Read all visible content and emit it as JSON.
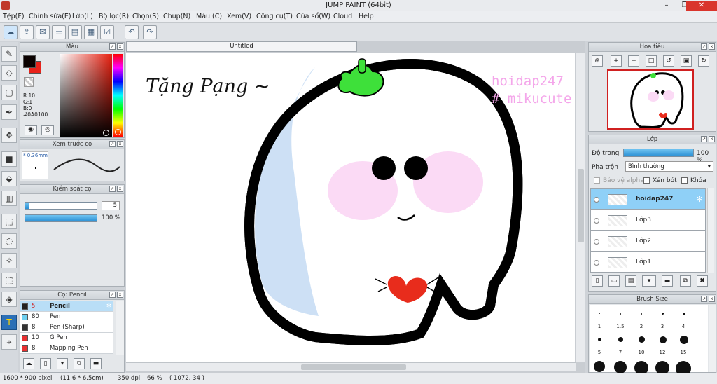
{
  "window": {
    "title": "JUMP PAINT (64bit)",
    "minimize": "–",
    "maximize": "❐",
    "close": "✕"
  },
  "menu": [
    "Tệp(F)",
    "Chỉnh sửa(E)",
    "Lớp(L)",
    "Bộ lọc(R)",
    "Chọn(S)",
    "Chụp(N)",
    "Màu (C)",
    "Xem(V)",
    "Công cụ(T)",
    "Cửa sổ(W)",
    "Cloud",
    "Help"
  ],
  "toolbar": {
    "undo": "↶",
    "redo": "↷"
  },
  "color_panel": {
    "title": "Màu",
    "r": "R:10",
    "g": "G:1",
    "b": "B:0",
    "hex": "#0A0100",
    "main_color": "#0a0100",
    "sub_color": "#e8221a"
  },
  "brush_preview": {
    "title": "Xem trước cọ",
    "size": "0.36mm"
  },
  "brush_control": {
    "title": "Kiểm soát cọ",
    "size_value": "5",
    "opacity_label": "100 %",
    "size_fraction": 0.05,
    "opacity_fraction": 1.0
  },
  "brush_list": {
    "title": "Cọ: Pencil",
    "items": [
      {
        "size": "5",
        "name": "Pencil",
        "color": "#222222"
      },
      {
        "size": "80",
        "name": "Pen",
        "color": "#6fd0f0"
      },
      {
        "size": "8",
        "name": "Pen (Sharp)",
        "color": "#333333"
      },
      {
        "size": "10",
        "name": "G Pen",
        "color": "#e83030"
      },
      {
        "size": "8",
        "name": "Mapping Pen",
        "color": "#e83030"
      }
    ]
  },
  "document": {
    "tab": "Untitled"
  },
  "canvas_text": {
    "handwriting": "Tặng Pạng ~",
    "watermark_line1": "hoidap247",
    "watermark_line2": "# mikucute"
  },
  "navigator": {
    "title": "Hoa tiêu"
  },
  "layers": {
    "title": "Lớp",
    "opacity_label": "Độ trong",
    "opacity_value": "100 %",
    "opacity_fraction": 1.0,
    "blend_label": "Pha trộn",
    "blend_value": "Bình thường",
    "protect_alpha": "Bảo vệ alpha",
    "clipping": "Xén bớt",
    "lock": "Khóa",
    "items": [
      {
        "name": "hoidap247"
      },
      {
        "name": "Lớp3"
      },
      {
        "name": "Lớp2"
      },
      {
        "name": "Lớp1"
      }
    ]
  },
  "brush_size": {
    "title": "Brush Size",
    "labels": [
      "1",
      "1.5",
      "2",
      "3",
      "4",
      "5",
      "7",
      "10",
      "12",
      "15"
    ]
  },
  "status": {
    "doc_size": "1600 * 900 pixel",
    "phys_size": "(11.6 * 6.5cm)",
    "dpi": "350 dpi",
    "zoom": "66 %",
    "coords": "( 1072, 34 )"
  }
}
